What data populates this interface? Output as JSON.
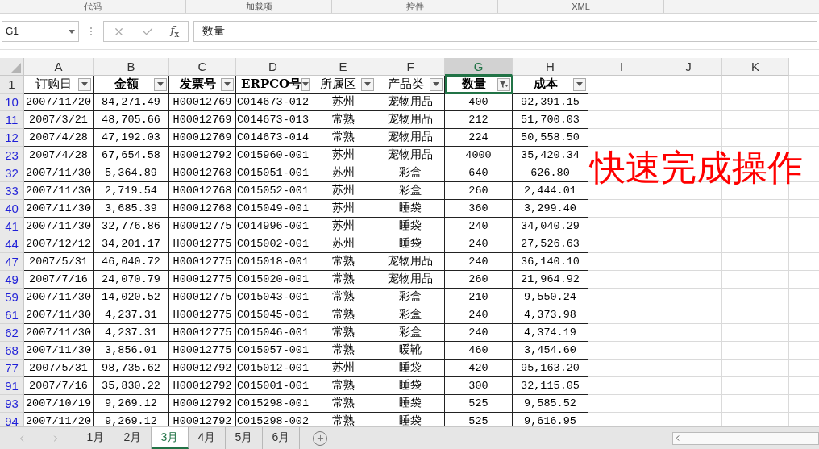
{
  "ribbon_groups": [
    "代码",
    "加载项",
    "控件",
    "XML"
  ],
  "name_box": "G1",
  "formula_icon": "*f*$_{x}$",
  "formula": "数量",
  "column_letters": [
    {
      "label": "A",
      "selected": false
    },
    {
      "label": "B",
      "selected": false
    },
    {
      "label": "C",
      "selected": false
    },
    {
      "label": "D",
      "selected": false
    },
    {
      "label": "E",
      "selected": false
    },
    {
      "label": "F",
      "selected": false
    },
    {
      "label": "G",
      "selected": true
    },
    {
      "label": "H",
      "selected": false
    },
    {
      "label": "I",
      "selected": false
    },
    {
      "label": "J",
      "selected": false
    },
    {
      "label": "K",
      "selected": false
    }
  ],
  "header_row": {
    "number": "1",
    "cells": [
      {
        "text": "订购日",
        "bold": false,
        "filtered": false,
        "selected": false
      },
      {
        "text": "金额",
        "bold": true,
        "filtered": false,
        "selected": false
      },
      {
        "text": "发票号",
        "bold": true,
        "filtered": false,
        "selected": false
      },
      {
        "text": "ERPCO号",
        "bold": true,
        "filtered": false,
        "selected": false
      },
      {
        "text": "所属区",
        "bold": false,
        "filtered": false,
        "selected": false
      },
      {
        "text": "产品类",
        "bold": false,
        "filtered": false,
        "selected": false
      },
      {
        "text": "数量",
        "bold": true,
        "filtered": true,
        "selected": true
      },
      {
        "text": "成本",
        "bold": true,
        "filtered": false,
        "selected": false
      }
    ]
  },
  "rows": [
    {
      "number": "10",
      "cells": [
        "2007/11/20",
        "84,271.49",
        "H00012769",
        "C014673-012",
        "苏州",
        "宠物用品",
        "400",
        "92,391.15"
      ]
    },
    {
      "number": "11",
      "cells": [
        "2007/3/21",
        "48,705.66",
        "H00012769",
        "C014673-013",
        "常熟",
        "宠物用品",
        "212",
        "51,700.03"
      ]
    },
    {
      "number": "12",
      "cells": [
        "2007/4/28",
        "47,192.03",
        "H00012769",
        "C014673-014",
        "常熟",
        "宠物用品",
        "224",
        "50,558.50"
      ]
    },
    {
      "number": "23",
      "cells": [
        "2007/4/28",
        "67,654.58",
        "H00012792",
        "C015960-001",
        "苏州",
        "宠物用品",
        "4000",
        "35,420.34"
      ]
    },
    {
      "number": "32",
      "cells": [
        "2007/11/30",
        "5,364.89",
        "H00012768",
        "C015051-001",
        "苏州",
        "彩盒",
        "640",
        "626.80"
      ]
    },
    {
      "number": "33",
      "cells": [
        "2007/11/30",
        "2,719.54",
        "H00012768",
        "C015052-001",
        "苏州",
        "彩盒",
        "260",
        "2,444.01"
      ]
    },
    {
      "number": "40",
      "cells": [
        "2007/11/30",
        "3,685.39",
        "H00012768",
        "C015049-001",
        "苏州",
        "睡袋",
        "360",
        "3,299.40"
      ]
    },
    {
      "number": "41",
      "cells": [
        "2007/11/30",
        "32,776.86",
        "H00012775",
        "C014996-001",
        "苏州",
        "睡袋",
        "240",
        "34,040.29"
      ]
    },
    {
      "number": "44",
      "cells": [
        "2007/12/12",
        "34,201.17",
        "H00012775",
        "C015002-001",
        "苏州",
        "睡袋",
        "240",
        "27,526.63"
      ]
    },
    {
      "number": "47",
      "cells": [
        "2007/5/31",
        "46,040.72",
        "H00012775",
        "C015018-001",
        "常熟",
        "宠物用品",
        "240",
        "36,140.10"
      ]
    },
    {
      "number": "49",
      "cells": [
        "2007/7/16",
        "24,070.79",
        "H00012775",
        "C015020-001",
        "常熟",
        "宠物用品",
        "260",
        "21,964.92"
      ]
    },
    {
      "number": "59",
      "cells": [
        "2007/11/30",
        "14,020.52",
        "H00012775",
        "C015043-001",
        "常熟",
        "彩盒",
        "210",
        "9,550.24"
      ]
    },
    {
      "number": "61",
      "cells": [
        "2007/11/30",
        "4,237.31",
        "H00012775",
        "C015045-001",
        "常熟",
        "彩盒",
        "240",
        "4,373.98"
      ]
    },
    {
      "number": "62",
      "cells": [
        "2007/11/30",
        "4,237.31",
        "H00012775",
        "C015046-001",
        "常熟",
        "彩盒",
        "240",
        "4,374.19"
      ]
    },
    {
      "number": "68",
      "cells": [
        "2007/11/30",
        "3,856.01",
        "H00012775",
        "C015057-001",
        "常熟",
        "暖靴",
        "460",
        "3,454.60"
      ]
    },
    {
      "number": "77",
      "cells": [
        "2007/5/31",
        "98,735.62",
        "H00012792",
        "C015012-001",
        "苏州",
        "睡袋",
        "420",
        "95,163.20"
      ]
    },
    {
      "number": "91",
      "cells": [
        "2007/7/16",
        "35,830.22",
        "H00012792",
        "C015001-001",
        "常熟",
        "睡袋",
        "300",
        "32,115.05"
      ]
    },
    {
      "number": "93",
      "cells": [
        "2007/10/19",
        "9,269.12",
        "H00012792",
        "C015298-001",
        "常熟",
        "睡袋",
        "525",
        "9,585.52"
      ]
    },
    {
      "number": "94",
      "cells": [
        "2007/11/20",
        "9,269.12",
        "H00012792",
        "C015298-002",
        "常熟",
        "睡袋",
        "525",
        "9,616.95"
      ]
    }
  ],
  "overlay_text": "快速完成操作",
  "sheet_tabs": [
    {
      "label": "1月",
      "selected": false
    },
    {
      "label": "2月",
      "selected": false
    },
    {
      "label": "3月",
      "selected": true
    },
    {
      "label": "4月",
      "selected": false
    },
    {
      "label": "5月",
      "selected": false
    },
    {
      "label": "6月",
      "selected": false
    }
  ]
}
